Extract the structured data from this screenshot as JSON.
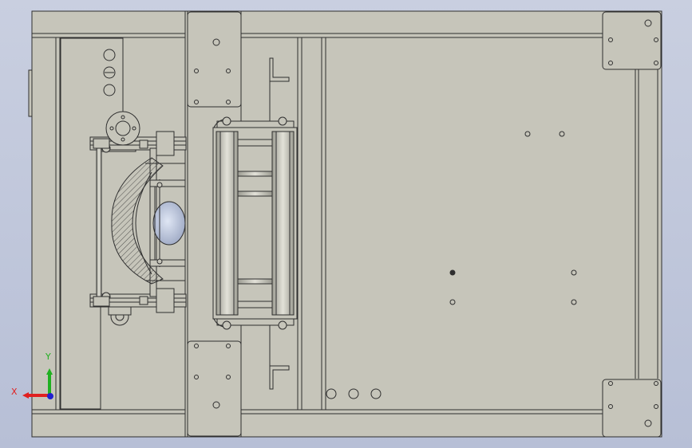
{
  "viewport": {
    "background_top": "#c9cfe0",
    "background_bottom": "#b7bfd6",
    "part_fill": "#c6c5ba",
    "edge_color": "#2f2f2f"
  },
  "triad": {
    "x_label": "X",
    "y_label": "Y",
    "x_color": "#e02020",
    "y_color": "#20b020",
    "z_color": "#2020d0"
  }
}
